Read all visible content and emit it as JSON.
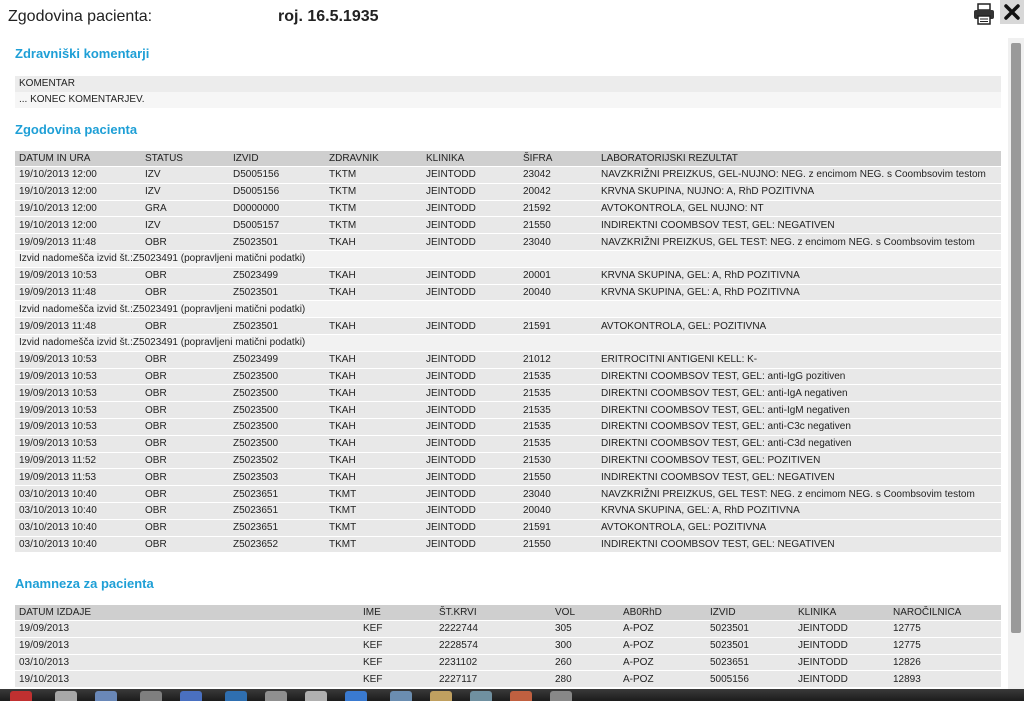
{
  "header": {
    "title": "Zgodovina pacienta:",
    "dob": "roj. 16.5.1935",
    "print_icon": "printer-icon",
    "close_icon": "close-icon"
  },
  "comments": {
    "title": "Zdravniški komentarji",
    "lines": [
      "KOMENTAR",
      "... KONEC KOMENTARJEV."
    ]
  },
  "history": {
    "title": "Zgodovina pacienta",
    "columns": [
      "DATUM IN URA",
      "STATUS",
      "IZVID",
      "ZDRAVNIK",
      "KLINIKA",
      "ŠIFRA",
      "LABORATORIJSKI REZULTAT"
    ],
    "rows": [
      {
        "type": "data",
        "cells": [
          "19/10/2013 12:00",
          "IZV",
          "D5005156",
          "TKTM",
          "JEINTODD",
          "23042",
          "NAVZKRIŽNI PREIZKUS, GEL-NUJNO: NEG. z encimom NEG. s Coombsovim testom"
        ]
      },
      {
        "type": "data",
        "cells": [
          "19/10/2013 12:00",
          "IZV",
          "D5005156",
          "TKTM",
          "JEINTODD",
          "20042",
          "KRVNA SKUPINA, NUJNO: A, RhD POZITIVNA"
        ]
      },
      {
        "type": "data",
        "cells": [
          "19/10/2013 12:00",
          "GRA",
          "D0000000",
          "TKTM",
          "JEINTODD",
          "21592",
          "AVTOKONTROLA, GEL NUJNO: NT"
        ]
      },
      {
        "type": "data",
        "cells": [
          "19/10/2013 12:00",
          "IZV",
          "D5005157",
          "TKTM",
          "JEINTODD",
          "21550",
          "INDIREKTNI COOMBSOV TEST, GEL: NEGATIVEN"
        ]
      },
      {
        "type": "data",
        "cells": [
          "19/09/2013 11:48",
          "OBR",
          "Z5023501",
          "TKAH",
          "JEINTODD",
          "23040",
          "NAVZKRIŽNI PREIZKUS, GEL TEST: NEG. z encimom NEG. s Coombsovim testom"
        ]
      },
      {
        "type": "note",
        "text": "Izvid nadomešča izvid št.:Z5023491 (popravljeni matični podatki)"
      },
      {
        "type": "data",
        "cells": [
          "19/09/2013 10:53",
          "OBR",
          "Z5023499",
          "TKAH",
          "JEINTODD",
          "20001",
          "KRVNA SKUPINA, GEL: A, RhD POZITIVNA"
        ]
      },
      {
        "type": "data",
        "cells": [
          "19/09/2013 11:48",
          "OBR",
          "Z5023501",
          "TKAH",
          "JEINTODD",
          "20040",
          "KRVNA SKUPINA, GEL: A, RhD POZITIVNA"
        ]
      },
      {
        "type": "note",
        "text": "Izvid nadomešča izvid št.:Z5023491 (popravljeni matični podatki)"
      },
      {
        "type": "data",
        "cells": [
          "19/09/2013 11:48",
          "OBR",
          "Z5023501",
          "TKAH",
          "JEINTODD",
          "21591",
          "AVTOKONTROLA, GEL: POZITIVNA"
        ]
      },
      {
        "type": "note",
        "text": "Izvid nadomešča izvid št.:Z5023491 (popravljeni matični podatki)"
      },
      {
        "type": "data",
        "cells": [
          "19/09/2013 10:53",
          "OBR",
          "Z5023499",
          "TKAH",
          "JEINTODD",
          "21012",
          "ERITROCITNI ANTIGENI KELL: K-"
        ]
      },
      {
        "type": "data",
        "cells": [
          "19/09/2013 10:53",
          "OBR",
          "Z5023500",
          "TKAH",
          "JEINTODD",
          "21535",
          "DIREKTNI COOMBSOV TEST, GEL: anti-IgG pozitiven"
        ]
      },
      {
        "type": "data",
        "cells": [
          "19/09/2013 10:53",
          "OBR",
          "Z5023500",
          "TKAH",
          "JEINTODD",
          "21535",
          "DIREKTNI COOMBSOV TEST, GEL: anti-IgA negativen"
        ]
      },
      {
        "type": "data",
        "cells": [
          "19/09/2013 10:53",
          "OBR",
          "Z5023500",
          "TKAH",
          "JEINTODD",
          "21535",
          "DIREKTNI COOMBSOV TEST, GEL: anti-IgM negativen"
        ]
      },
      {
        "type": "data",
        "cells": [
          "19/09/2013 10:53",
          "OBR",
          "Z5023500",
          "TKAH",
          "JEINTODD",
          "21535",
          "DIREKTNI COOMBSOV TEST, GEL: anti-C3c negativen"
        ]
      },
      {
        "type": "data",
        "cells": [
          "19/09/2013 10:53",
          "OBR",
          "Z5023500",
          "TKAH",
          "JEINTODD",
          "21535",
          "DIREKTNI COOMBSOV TEST, GEL: anti-C3d negativen"
        ]
      },
      {
        "type": "data",
        "cells": [
          "19/09/2013 11:52",
          "OBR",
          "Z5023502",
          "TKAH",
          "JEINTODD",
          "21530",
          "DIREKTNI COOMBSOV TEST, GEL: POZITIVEN"
        ]
      },
      {
        "type": "data",
        "cells": [
          "19/09/2013 11:53",
          "OBR",
          "Z5023503",
          "TKAH",
          "JEINTODD",
          "21550",
          "INDIREKTNI COOMBSOV TEST, GEL: NEGATIVEN"
        ]
      },
      {
        "type": "data",
        "cells": [
          "03/10/2013 10:40",
          "OBR",
          "Z5023651",
          "TKMT",
          "JEINTODD",
          "23040",
          "NAVZKRIŽNI PREIZKUS, GEL TEST: NEG. z encimom NEG. s Coombsovim testom"
        ]
      },
      {
        "type": "data",
        "cells": [
          "03/10/2013 10:40",
          "OBR",
          "Z5023651",
          "TKMT",
          "JEINTODD",
          "20040",
          "KRVNA SKUPINA, GEL: A, RhD POZITIVNA"
        ]
      },
      {
        "type": "data",
        "cells": [
          "03/10/2013 10:40",
          "OBR",
          "Z5023651",
          "TKMT",
          "JEINTODD",
          "21591",
          "AVTOKONTROLA, GEL: POZITIVNA"
        ]
      },
      {
        "type": "data",
        "cells": [
          "03/10/2013 10:40",
          "OBR",
          "Z5023652",
          "TKMT",
          "JEINTODD",
          "21550",
          "INDIREKTNI COOMBSOV TEST, GEL: NEGATIVEN"
        ]
      }
    ]
  },
  "anamnesis": {
    "title": "Anamneza za pacienta",
    "columns": [
      "DATUM IZDAJE",
      "IME",
      "ŠT.KRVI",
      "VOL",
      "AB0RhD",
      "IZVID",
      "KLINIKA",
      "NAROČILNICA"
    ],
    "rows": [
      [
        "19/09/2013",
        "KEF",
        "2222744",
        "305",
        "A-POZ",
        "5023501",
        "JEINTODD",
        "12775"
      ],
      [
        "19/09/2013",
        "KEF",
        "2228574",
        "300",
        "A-POZ",
        "5023501",
        "JEINTODD",
        "12775"
      ],
      [
        "03/10/2013",
        "KEF",
        "2231102",
        "260",
        "A-POZ",
        "5023651",
        "JEINTODD",
        "12826"
      ],
      [
        "19/10/2013",
        "KEF",
        "2227117",
        "280",
        "A-POZ",
        "5005156",
        "JEINTODD",
        "12893"
      ]
    ]
  },
  "colors": {
    "section_title": "#1e9fd6",
    "header_row": "#cfcfcf",
    "data_row": "#e8e8e8"
  }
}
